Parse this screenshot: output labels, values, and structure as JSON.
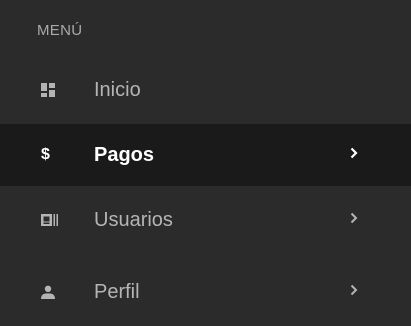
{
  "sidebar": {
    "section_title": "MENÚ",
    "items": [
      {
        "label": "Inicio",
        "icon": "dashboard-icon",
        "has_chevron": false,
        "active": false
      },
      {
        "label": "Pagos",
        "icon": "dollar-icon",
        "icon_text": "$",
        "has_chevron": true,
        "active": true
      },
      {
        "label": "Usuarios",
        "icon": "id-card-icon",
        "has_chevron": true,
        "active": false
      },
      {
        "label": "Perfil",
        "icon": "person-icon",
        "has_chevron": true,
        "active": false
      }
    ]
  },
  "colors": {
    "background": "#2b2b2b",
    "active_background": "#1a1a1a",
    "text_inactive": "#b4b4b4",
    "text_active": "#ffffff",
    "header_text": "#a9a9a9"
  }
}
